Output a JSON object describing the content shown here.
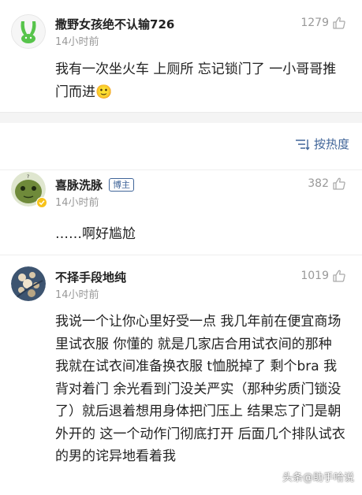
{
  "comments": [
    {
      "username": "撒野女孩绝不认输726",
      "time": "14小时前",
      "likes": "1279",
      "text": "我有一次坐火车  上厕所 忘记锁门了 一小哥哥推门而进🙂"
    },
    {
      "username": "喜脉洗脉",
      "badge": "博主",
      "time": "14小时前",
      "likes": "382",
      "text": "……啊好尴尬"
    },
    {
      "username": "不择手段地纯",
      "time": "14小时前",
      "likes": "1019",
      "text": "我说一个让你心里好受一点 我几年前在便宜商场里试衣服 你懂的 就是几家店合用试衣间的那种 我就在试衣间准备换衣服 t恤脱掉了 剩个bra 我背对着门 余光看到门没关严实（那种劣质门锁没了）就后退着想用身体把门压上 结果忘了门是朝外开的 这一个动作门彻底打开 后面几个排队试衣的男的诧异地看着我"
    }
  ],
  "sort": {
    "label": "按热度"
  },
  "watermark": "头条@助手哈说",
  "colors": {
    "link": "#406599",
    "muted": "#999999",
    "divider": "#f4f4f4"
  },
  "icons": {
    "like": "thumbs-up-icon",
    "sort": "sort-lines-icon"
  }
}
